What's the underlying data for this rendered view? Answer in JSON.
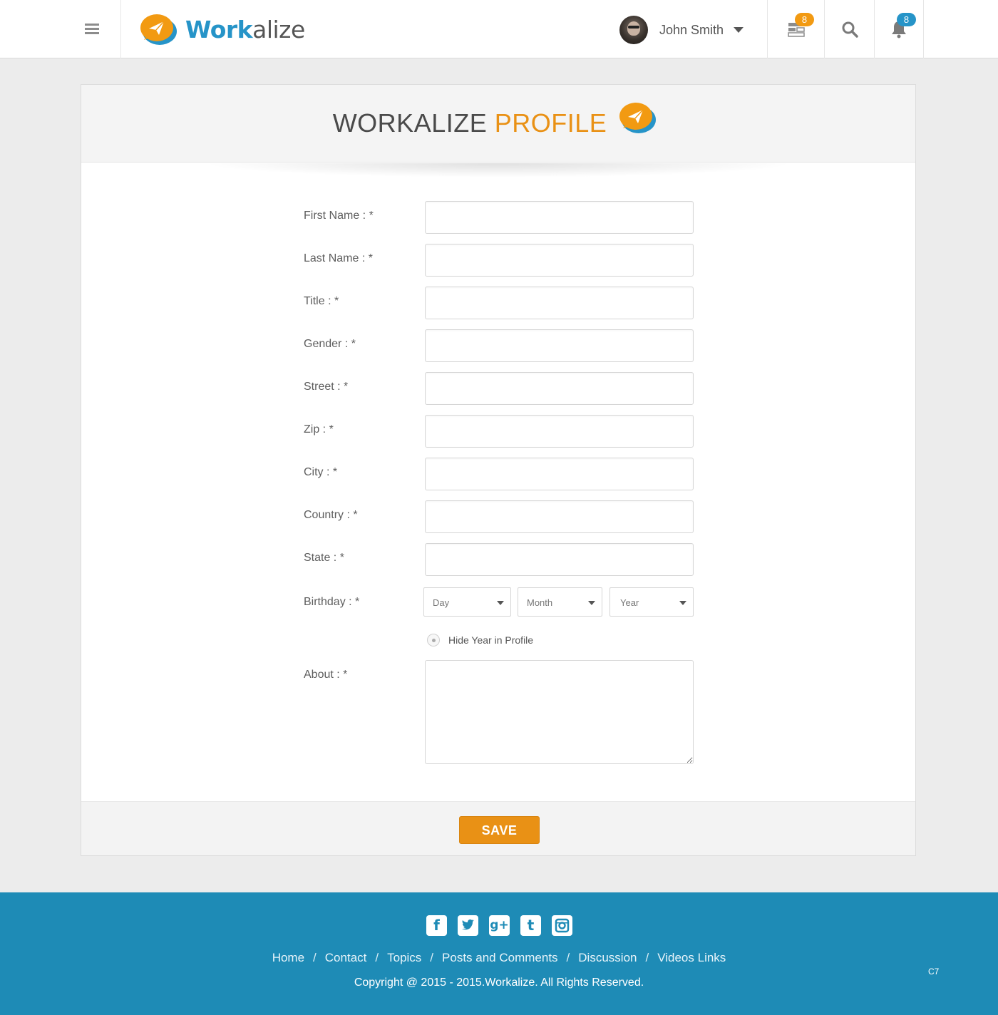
{
  "header": {
    "logo_blue": "Work",
    "logo_grey": "alize",
    "user_name": "John Smith",
    "messages_badge": "8",
    "notifications_badge": "8",
    "menu_icon": "hamburger-icon",
    "search_icon": "search-icon",
    "bell_icon": "bell-icon",
    "messages_icon": "messages-icon"
  },
  "profile": {
    "title_dark": "WORKALIZE",
    "title_orange": "PROFILE",
    "fields": [
      {
        "label": "First Name : *",
        "value": ""
      },
      {
        "label": "Last Name : *",
        "value": ""
      },
      {
        "label": "Title : *",
        "value": ""
      },
      {
        "label": "Gender : *",
        "value": ""
      },
      {
        "label": "Street : *",
        "value": ""
      },
      {
        "label": "Zip : *",
        "value": ""
      },
      {
        "label": "City : *",
        "value": ""
      },
      {
        "label": "Country : *",
        "value": ""
      },
      {
        "label": "State : *",
        "value": ""
      }
    ],
    "birthday": {
      "label": "Birthday : *",
      "day": "Day",
      "month": "Month",
      "year": "Year"
    },
    "hide_year_label": "Hide Year in Profile",
    "about_label": "About : *",
    "save_label": "SAVE"
  },
  "footer": {
    "social": [
      "facebook-icon",
      "twitter-icon",
      "google-plus-icon",
      "tumblr-icon",
      "instagram-icon"
    ],
    "links": [
      "Home",
      "Contact",
      "Topics",
      "Posts and Comments",
      "Discussion",
      "Videos Links"
    ],
    "copyright": "Copyright @ 2015 - 2015.Workalize. All Rights Reserved.",
    "version": "C7"
  },
  "colors": {
    "accent_orange": "#e99115",
    "brand_blue": "#2694c8",
    "footer_blue": "#1e8bb6"
  }
}
